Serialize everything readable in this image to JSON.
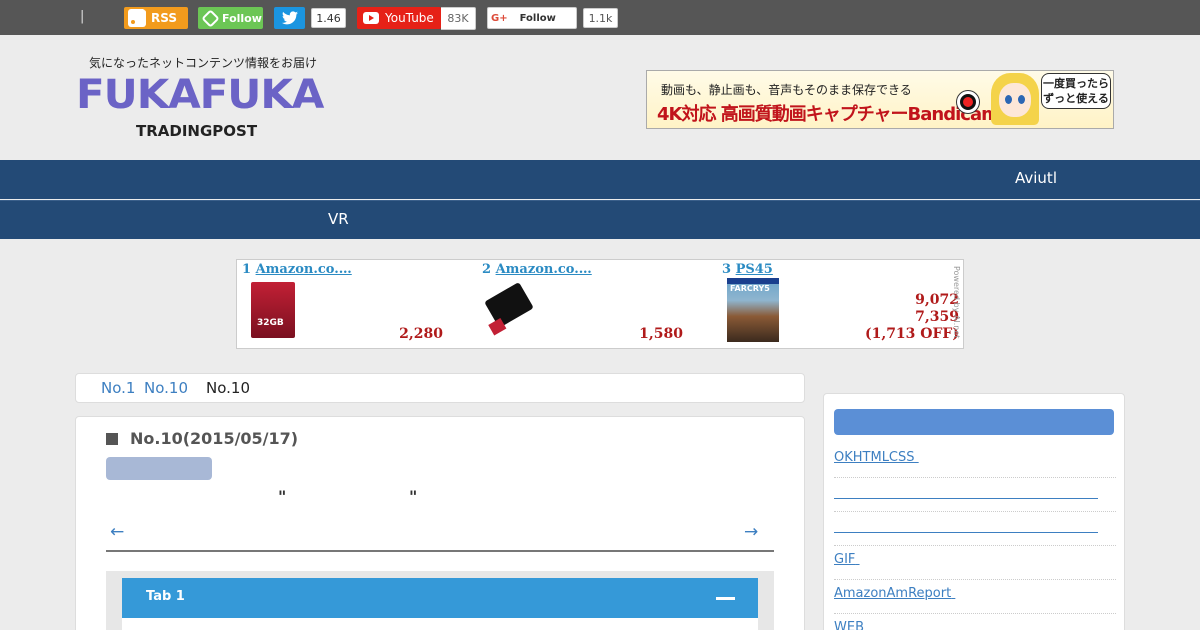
{
  "topbar": {
    "separator": "|",
    "rss_label": "RSS",
    "feedly_label": "Follow",
    "twitter_count": "1.46",
    "youtube_label": "YouTube",
    "youtube_count": "83K",
    "gplus_prefix": "G+",
    "gplus_label": "Follow",
    "gplus_count": "1.1k"
  },
  "header": {
    "tagline": "気になったネットコンテンツ情報をお届け",
    "logo_main": "FUKAFUKA",
    "logo_sub": "TRADINGPOST",
    "banner": {
      "line1": "動画も、静止画も、音声もそのまま保存できる",
      "line2": "4K対応 高画質動画キャプチャーBandicam",
      "bubble": "一度買ったらずっと使える"
    }
  },
  "nav": {
    "row1_item": "Aviutl",
    "row2_item": "VR"
  },
  "ranking": {
    "items": [
      {
        "rank": "1",
        "title": "Amazon.co.…",
        "price": "2,280"
      },
      {
        "rank": "2",
        "title": "Amazon.co.…",
        "price": "1,580"
      },
      {
        "rank": "3",
        "title": "PS45",
        "price_list": "9,072",
        "price": "7,359",
        "discount": "(1,713 OFF)"
      }
    ],
    "powered": "Powered by AI.net"
  },
  "breadcrumb": {
    "items": [
      "No.1",
      "No.10",
      "No.10"
    ]
  },
  "article": {
    "title": "No.10(2015/05/17)",
    "quote_open": "\"",
    "quote_close": "\"",
    "prev_arrow": "←",
    "next_arrow": "→",
    "tab_label": "Tab 1"
  },
  "sidebar": {
    "links": [
      "OKHTMLCSS",
      "",
      "",
      "GIF",
      "AmazonAmReport",
      "WEB"
    ]
  },
  "colors": {
    "nav_bg": "#234a76",
    "link": "#3d7fc1",
    "tab_head": "#3599d8",
    "price": "#b01a1a"
  }
}
